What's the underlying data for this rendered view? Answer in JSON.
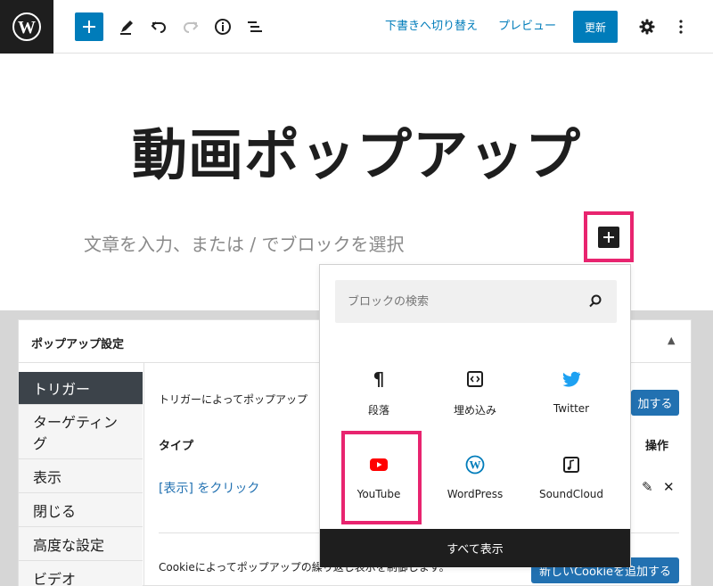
{
  "toolbar": {
    "switch_to_draft": "下書きへ切り替え",
    "preview": "プレビュー",
    "update": "更新"
  },
  "editor": {
    "title": "動画ポップアップ",
    "paragraph_placeholder": "文章を入力、または / でブロックを選択"
  },
  "inserter": {
    "search_placeholder": "ブロックの検索",
    "blocks": [
      {
        "label": "段落",
        "icon": "paragraph-icon"
      },
      {
        "label": "埋め込み",
        "icon": "embed-icon"
      },
      {
        "label": "Twitter",
        "icon": "twitter-icon"
      },
      {
        "label": "YouTube",
        "icon": "youtube-icon"
      },
      {
        "label": "WordPress",
        "icon": "wordpress-icon"
      },
      {
        "label": "SoundCloud",
        "icon": "soundcloud-icon"
      }
    ],
    "show_all": "すべて表示"
  },
  "meta_box": {
    "title": "ポップアップ設定",
    "tabs": [
      {
        "label": "トリガー",
        "active": true
      },
      {
        "label": "ターゲティング"
      },
      {
        "label": "表示"
      },
      {
        "label": "閉じる"
      },
      {
        "label": "高度な設定"
      },
      {
        "label": "ビデオ"
      }
    ],
    "trigger_description": "トリガーによってポップアップ",
    "add_trigger_button": "加する",
    "col_type": "タイプ",
    "col_actions": "操作",
    "trigger_row": "[表示] をクリック",
    "cookie_description": "Cookieによってポップアップの繰り返し表示を制御します。",
    "add_cookie_button": "新しいCookieを追加する"
  },
  "colors": {
    "accent": "#007cba",
    "highlight": "#e8246f",
    "youtube": "#ff0000",
    "twitter": "#1da1f2"
  }
}
